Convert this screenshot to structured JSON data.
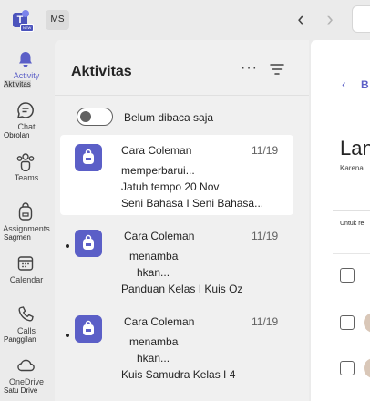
{
  "topbar": {
    "app_name": "Teams",
    "badge": "NEW",
    "tenant": "MS"
  },
  "rail": [
    {
      "label": "Activity",
      "label_local": "Aktivitas",
      "icon": "bell-icon",
      "active": true
    },
    {
      "label": "Chat",
      "label_local": "Obrolan",
      "icon": "chat-icon",
      "active": false
    },
    {
      "label": "Teams",
      "label_local": "",
      "icon": "teams-icon",
      "active": false
    },
    {
      "label": "Assignments",
      "label_local": "Sagmen",
      "icon": "backpack-icon",
      "active": false
    },
    {
      "label": "Calendar",
      "label_local": "",
      "icon": "calendar-icon",
      "active": false
    },
    {
      "label": "Calls",
      "label_local": "Panggilan",
      "icon": "phone-icon",
      "active": false
    },
    {
      "label": "OneDrive",
      "label_local": "Satu Drive",
      "icon": "cloud-icon",
      "active": false
    }
  ],
  "activity": {
    "title": "Aktivitas",
    "more": "···",
    "toggle_label": "Belum dibaca saja",
    "feed": [
      {
        "sender": "Cara Coleman",
        "date": "11/19",
        "lines": [
          "memperbarui...",
          "Jatuh tempo 20 Nov",
          "Seni Bahasa I Seni Bahasa..."
        ],
        "unread": false,
        "selected": true
      },
      {
        "sender": "Cara Coleman",
        "date": "11/19",
        "lines": [
          "menamba",
          "hkan...",
          "Panduan Kelas I Kuis Oz"
        ],
        "unread": true,
        "selected": false
      },
      {
        "sender": "Cara Coleman",
        "date": "11/19",
        "lines": [
          "menamba",
          "hkan...",
          "Kuis Samudra Kelas I 4"
        ],
        "unread": true,
        "selected": false
      }
    ]
  },
  "detail": {
    "back_label": "B",
    "title": "Lan",
    "subtitle": "Karena",
    "column": "Untuk re",
    "colors": {
      "accent": "#5b5fc7",
      "avatar_bg": "#5b5fc7"
    }
  }
}
